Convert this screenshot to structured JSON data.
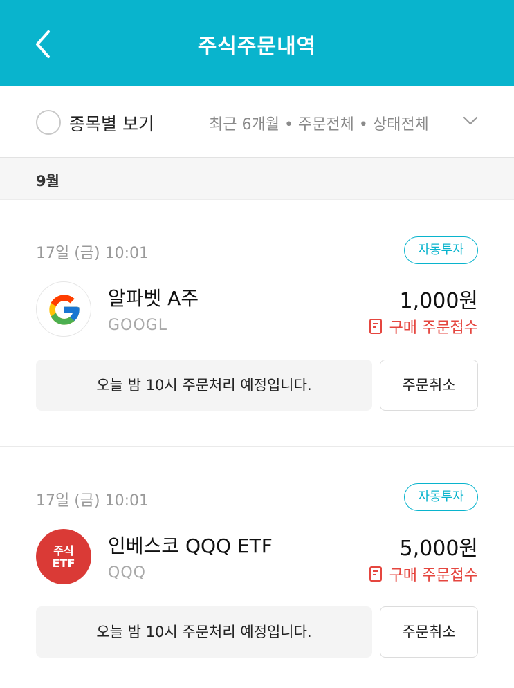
{
  "header": {
    "title": "주식주문내역",
    "back_icon": "chevron-left-icon",
    "bg_color": "#09B4CD"
  },
  "filter": {
    "radio_label": "종목별 보기",
    "radio_checked": false,
    "summary": "최근 6개월 • 주문전체 • 상태전체",
    "dropdown_icon": "chevron-down-icon"
  },
  "month": {
    "label": "9월"
  },
  "orders": [
    {
      "date": "17일 (금) 10:01",
      "badge": "자동투자",
      "logo": "google-logo",
      "name": "알파벳 A주",
      "ticker": "GOOGL",
      "amount": "1,000원",
      "status": "구매 주문접수",
      "status_icon": "receipt-icon",
      "notice": "오늘 밤 10시 주문처리 예정입니다.",
      "cancel_label": "주문취소"
    },
    {
      "date": "17일 (금) 10:01",
      "badge": "자동투자",
      "logo_line1": "주식",
      "logo_line2": "ETF",
      "name": "인베스코 QQQ ETF",
      "ticker": "QQQ",
      "amount": "5,000원",
      "status": "구매 주문접수",
      "status_icon": "receipt-icon",
      "notice": "오늘 밤 10시 주문처리 예정입니다.",
      "cancel_label": "주문취소"
    }
  ],
  "colors": {
    "accent": "#09B4CD",
    "status_red": "#E5463F",
    "etf_red": "#DA3A36"
  }
}
